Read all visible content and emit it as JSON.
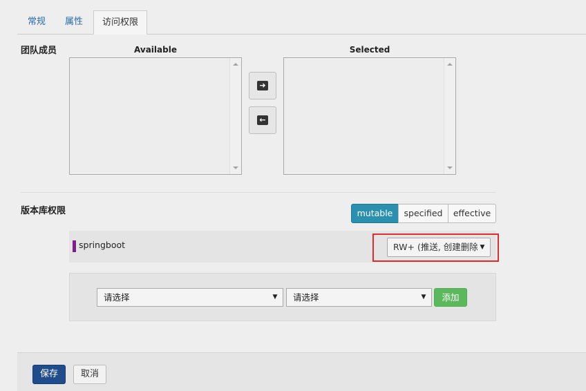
{
  "tabs": [
    {
      "label": "常规",
      "active": false
    },
    {
      "label": "属性",
      "active": false
    },
    {
      "label": "访问权限",
      "active": true
    }
  ],
  "team": {
    "label": "团队成员",
    "available_label": "Available",
    "selected_label": "Selected",
    "move_right_icon": "arrow-right-icon",
    "move_left_icon": "arrow-left-icon"
  },
  "repo_permissions": {
    "label": "版本库权限",
    "view_modes": [
      "mutable",
      "specified",
      "effective"
    ],
    "active_mode": "mutable",
    "rows": [
      {
        "name": "springboot",
        "permission": "RW+ (推送, 创建删除",
        "marker_color": "#7d1e8f"
      }
    ],
    "add_row": {
      "select1": "请选择",
      "select2": "请选择",
      "add_label": "添加"
    }
  },
  "footer": {
    "save_label": "保存",
    "cancel_label": "取消"
  },
  "colors": {
    "accent": "#2b8fb0",
    "save": "#1f4d8c",
    "add": "#5cb85c",
    "highlight": "#e12b2b"
  }
}
